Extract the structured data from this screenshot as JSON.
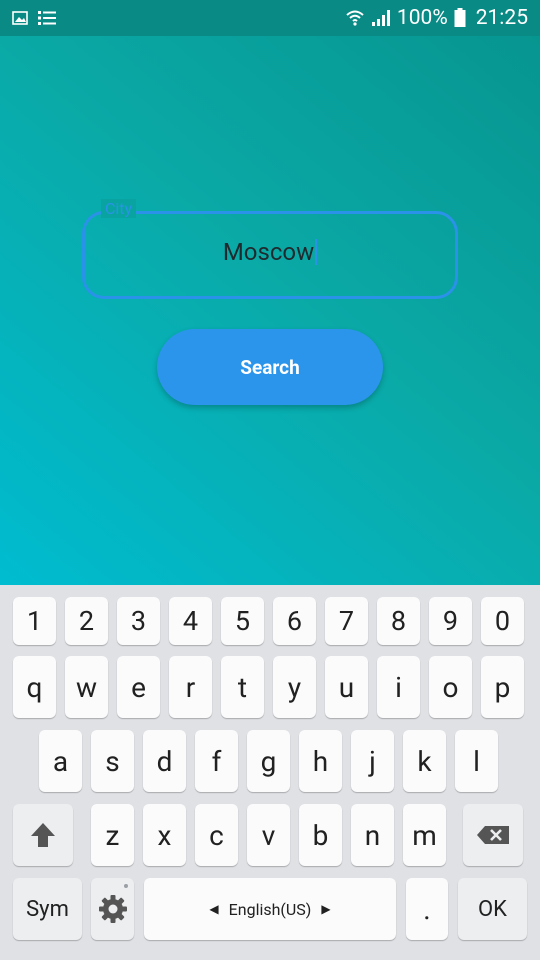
{
  "status_bar": {
    "battery_percent": "100%",
    "time": "21:25",
    "icons": [
      "image-icon",
      "list-icon",
      "wifi-icon",
      "signal-icon",
      "battery-icon"
    ]
  },
  "form": {
    "city_label": "City",
    "city_value": "Moscow",
    "search_label": "Search"
  },
  "keyboard": {
    "number_row": [
      "1",
      "2",
      "3",
      "4",
      "5",
      "6",
      "7",
      "8",
      "9",
      "0"
    ],
    "row1": [
      "q",
      "w",
      "e",
      "r",
      "t",
      "y",
      "u",
      "i",
      "o",
      "p"
    ],
    "row2": [
      "a",
      "s",
      "d",
      "f",
      "g",
      "h",
      "j",
      "k",
      "l"
    ],
    "row3": [
      "z",
      "x",
      "c",
      "v",
      "b",
      "n",
      "m"
    ],
    "sym_label": "Sym",
    "language_label": "English(US)",
    "period_label": ".",
    "ok_label": "OK"
  },
  "colors": {
    "status_bar": "#0a8a85",
    "accent_blue": "#2a92e8",
    "button_blue": "#2b95ec",
    "keyboard_bg": "#dfe1e5"
  }
}
